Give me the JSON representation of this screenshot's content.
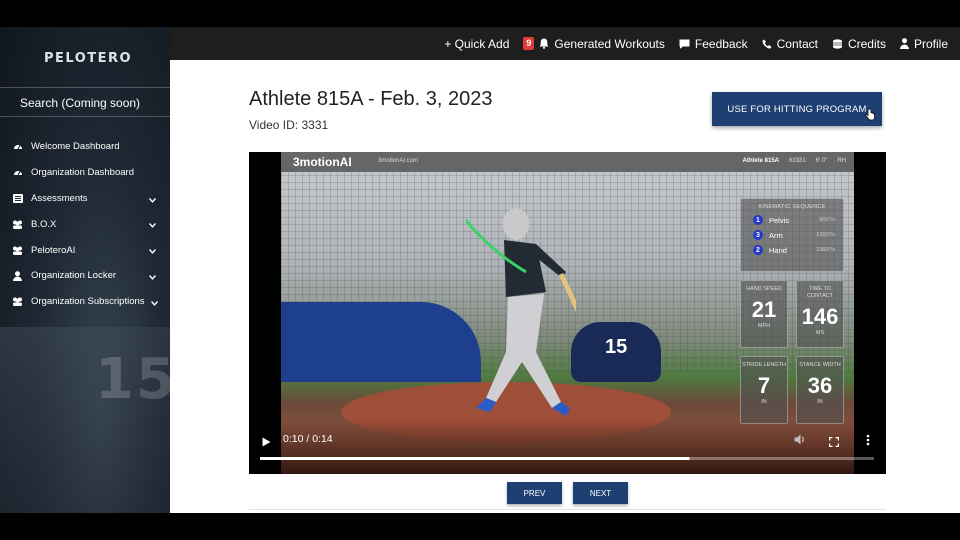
{
  "topnav": {
    "quick_add": "+ Quick Add",
    "notif_count": "9",
    "generated_workouts": "Generated Workouts",
    "feedback": "Feedback",
    "contact": "Contact",
    "credits": "Credits",
    "profile": "Profile"
  },
  "sidebar": {
    "logo": "PELOTERO",
    "search": "Search (Coming soon)",
    "items": [
      {
        "label": "Welcome Dashboard",
        "icon": "gauge-icon",
        "expandable": false
      },
      {
        "label": "Organization Dashboard",
        "icon": "gauge-icon",
        "expandable": false
      },
      {
        "label": "Assessments",
        "icon": "list-icon",
        "expandable": true
      },
      {
        "label": "B.O.X",
        "icon": "users-icon",
        "expandable": true
      },
      {
        "label": "PeloteroAI",
        "icon": "users-icon",
        "expandable": true
      },
      {
        "label": "Organization Locker",
        "icon": "user-icon",
        "expandable": true
      },
      {
        "label": "Organization Subscriptions",
        "icon": "users-icon",
        "expandable": true
      }
    ],
    "bg_jersey_number": "15"
  },
  "page": {
    "title": "Athlete 815A - Feb. 3, 2023",
    "video_id": "Video ID: 3331",
    "cta": "USE FOR HITTING PROGRAM"
  },
  "video": {
    "overlay_brand": "3motionAI",
    "overlay_url": "3motionAI.com",
    "overlay_athlete": "Athlete 815A",
    "overlay_meta": "63331",
    "overlay_height": "6' 0\"",
    "overlay_hand": "RH",
    "banner_number": "15",
    "kinematic_title": "KINEMATIC SEQUENCE",
    "sequence": [
      {
        "order": "1",
        "segment": "Pelvis",
        "value": "900°/s"
      },
      {
        "order": "3",
        "segment": "Arm",
        "value": "1360°/s"
      },
      {
        "order": "2",
        "segment": "Hand",
        "value": "1360°/s"
      }
    ],
    "metrics": [
      {
        "label": "HAND SPEED",
        "value": "21",
        "unit": "MPH"
      },
      {
        "label": "TIME TO CONTACT",
        "value": "146",
        "unit": "MS"
      },
      {
        "label": "STRIDE LENGTH",
        "value": "7",
        "unit": "IN"
      },
      {
        "label": "STANCE WIDTH",
        "value": "36",
        "unit": "IN"
      }
    ],
    "time": "0:10 / 0:14",
    "progress": 0.698,
    "buffered": 0.7
  },
  "pager": {
    "prev": "PREV",
    "next": "NEXT"
  }
}
